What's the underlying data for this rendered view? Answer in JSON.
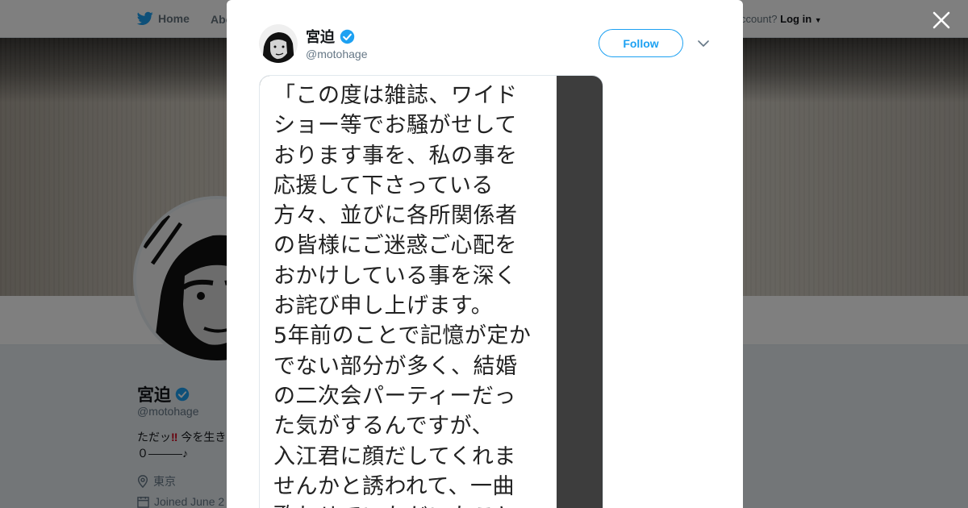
{
  "background_page": {
    "nav": {
      "home_label": "Home",
      "about_label": "Abo",
      "login_prefix": "ccount?",
      "login_label": "Log in"
    },
    "profile": {
      "name": "宮迫",
      "handle": "@motohage",
      "bio_prefix": "ただッ",
      "bio_bang": "‼",
      "bio_rest": " 今を生き",
      "bio_line2": "０―――♪",
      "location": "東京",
      "joined": "Joined June 2"
    }
  },
  "modal": {
    "author_name": "宮迫",
    "author_handle": "@motohage",
    "follow_label": "Follow",
    "image_text_lines": [
      "「この度は雑誌、ワイド",
      "ショー等でお騒がせして",
      "おります事を、私の事を",
      "応援して下さっている",
      "方々、並びに各所関係者",
      "の皆様にご迷惑ご心配を",
      "おかけしている事を深く",
      "お詫び申し上げます。",
      "5年前のことで記憶が定か",
      "でない部分が多く、結婚",
      "の二次会パーティーだっ",
      "た気がするんですが、",
      "入江君に顔だしてくれま",
      "せんかと誘われて、一曲",
      "歌わせていただいたこと"
    ]
  },
  "colors": {
    "twitter_blue": "#1da1f2",
    "verified_blue": "#1da1f2",
    "text_primary": "#14171a",
    "text_secondary": "#657786"
  },
  "icons": [
    "twitter-bird-icon",
    "verified-badge-icon",
    "close-icon",
    "chevron-down-icon",
    "location-pin-icon",
    "calendar-icon"
  ]
}
